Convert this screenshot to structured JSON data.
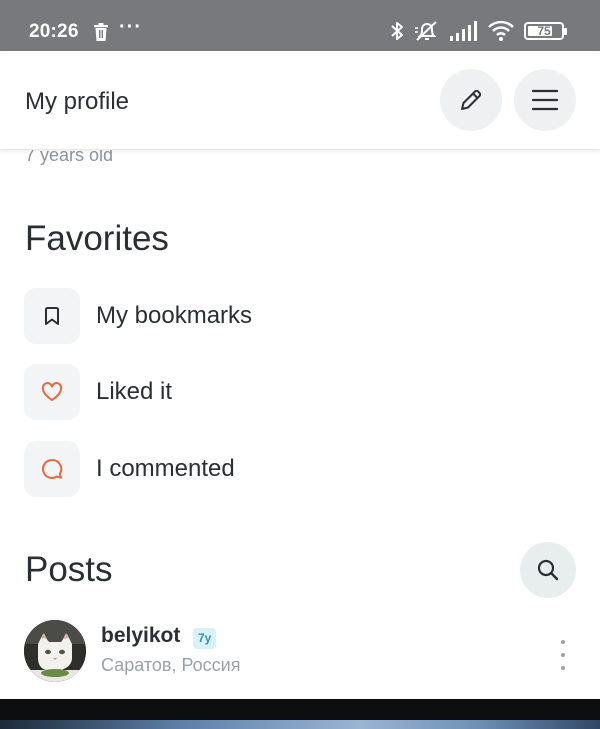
{
  "status_bar": {
    "time": "20:26",
    "battery": "75",
    "battery_level": 0.75,
    "icons": [
      "trash-icon",
      "more-dots-icon",
      "bluetooth-icon",
      "mute-icon",
      "signal-icon",
      "wifi-icon",
      "battery-icon"
    ],
    "dots": "···"
  },
  "header": {
    "title": "My profile",
    "edit_icon": "pencil-icon",
    "menu_icon": "hamburger-menu-icon"
  },
  "profile": {
    "age_text": "7 years old"
  },
  "favorites": {
    "title": "Favorites",
    "items": [
      {
        "label": "My bookmarks",
        "icon": "bookmark-icon",
        "icon_color": "#2b2f33"
      },
      {
        "label": "Liked it",
        "icon": "heart-icon",
        "icon_color": "#e8683f"
      },
      {
        "label": "I commented",
        "icon": "comment-icon",
        "icon_color": "#e8683f"
      }
    ]
  },
  "posts": {
    "title": "Posts",
    "search_icon": "search-icon",
    "first_post": {
      "author": "belyikot",
      "badge": "7y",
      "location": "Саратов, Россия"
    }
  },
  "colors": {
    "status_bar_bg": "#78797c",
    "accent_orange": "#e8683f",
    "badge_bg": "#d8f1f6",
    "badge_text": "#3b8fa3"
  }
}
